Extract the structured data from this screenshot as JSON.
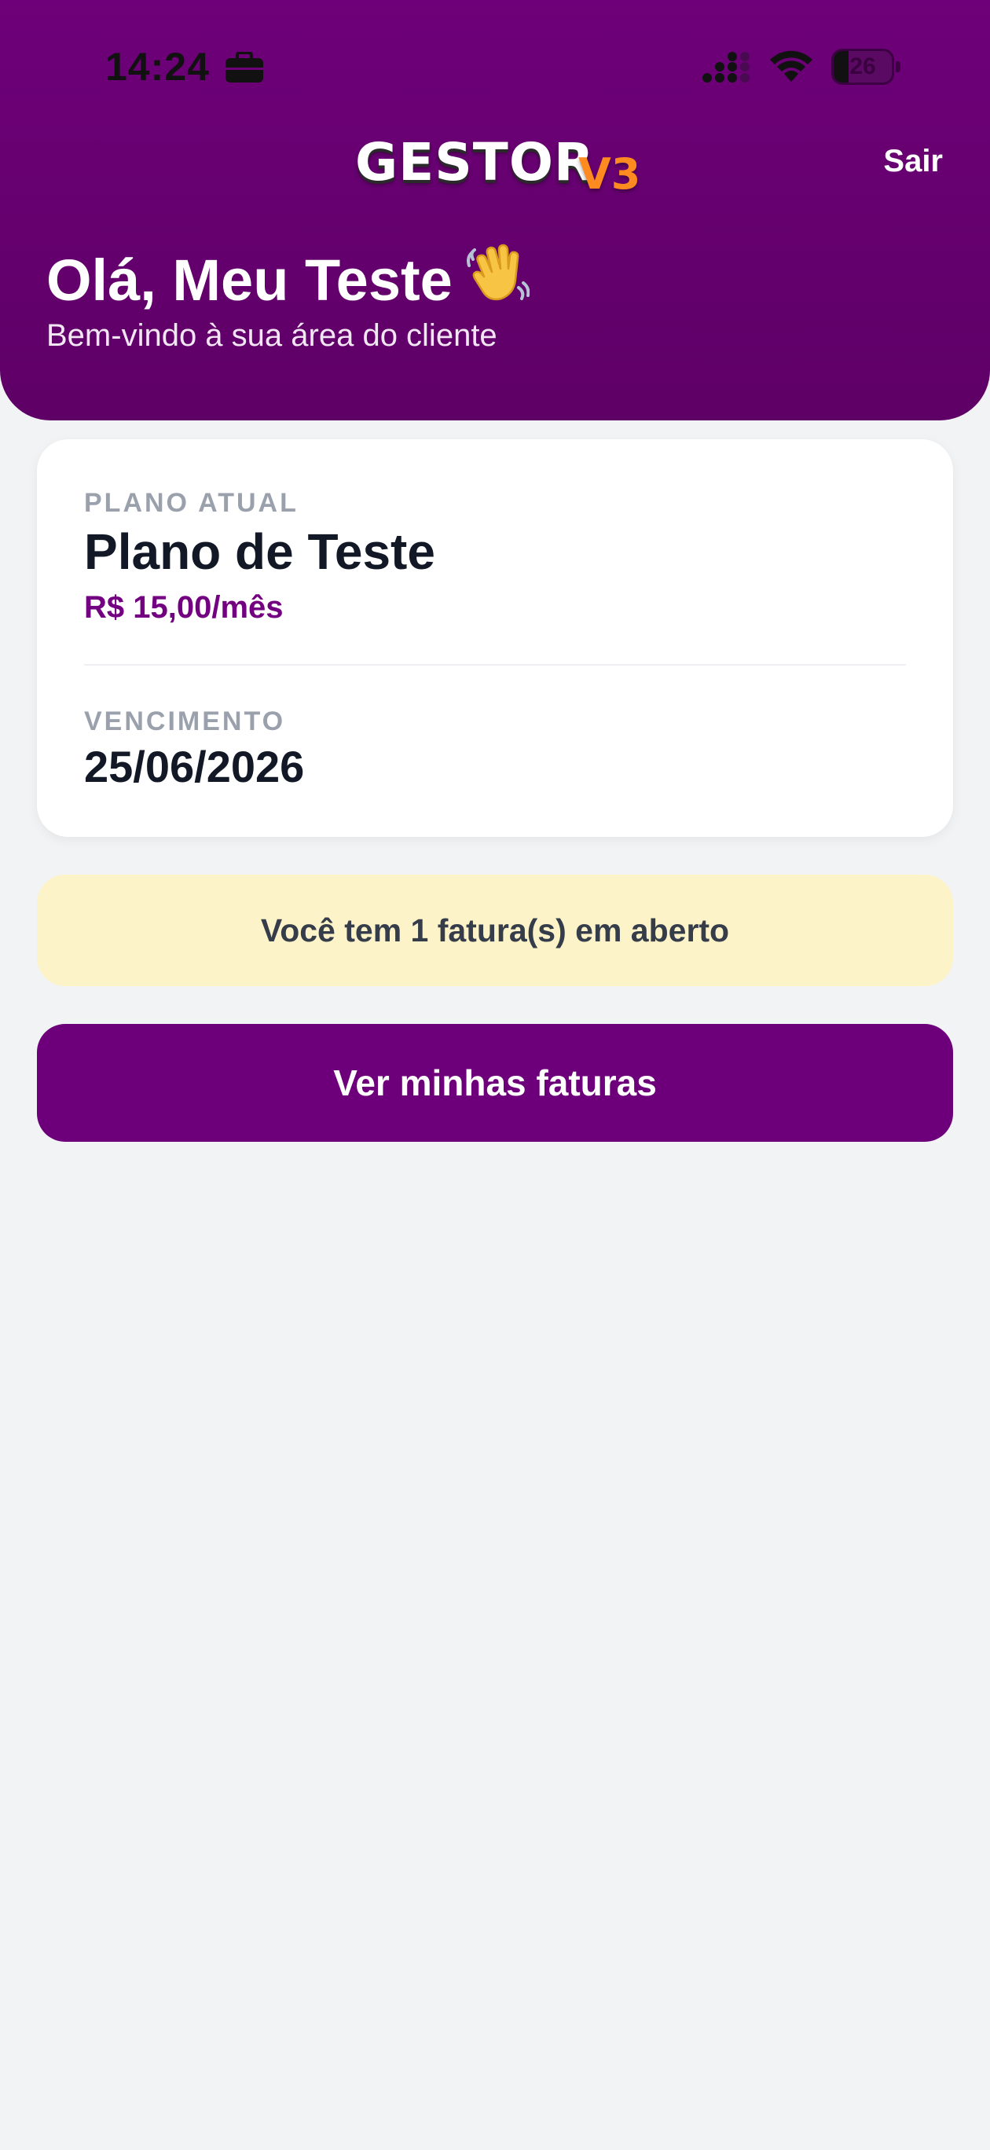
{
  "status_bar": {
    "time": "14:24",
    "battery_level": "26",
    "battery_fraction": 0.26
  },
  "header": {
    "logo_main": "GESTOR",
    "logo_sub": "V3",
    "logout_label": "Sair",
    "greeting": "Olá, Meu Teste",
    "subtitle": "Bem-vindo à sua área do cliente"
  },
  "plan_card": {
    "plan_label": "PLANO ATUAL",
    "plan_name": "Plano de Teste",
    "plan_price": "R$ 15,00/mês",
    "due_label": "VENCIMENTO",
    "due_date": "25/06/2026"
  },
  "alert": {
    "text": "Você tem 1 fatura(s) em aberto"
  },
  "actions": {
    "view_invoices_label": "Ver minhas faturas"
  },
  "colors": {
    "brand_purple": "#6d007a",
    "accent_orange": "#ff8a1f",
    "alert_background": "#fdf3c8"
  },
  "icons": {
    "status_left": "briefcase-icon",
    "signal": "signal-icon",
    "wifi": "wifi-icon",
    "greeting": "waving-hand-icon"
  }
}
